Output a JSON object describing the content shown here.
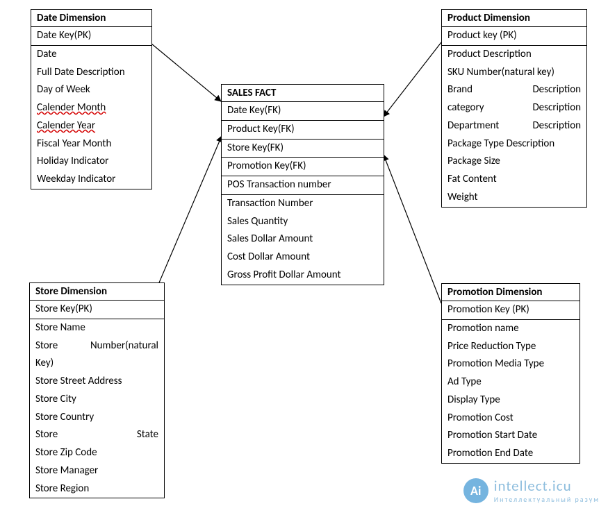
{
  "entities": {
    "date": {
      "title": "Date Dimension",
      "rows": [
        "Date Key(PK)",
        "Date",
        "Full Date Description",
        "Day of Week",
        "Calender Month",
        "Calender Year",
        "Fiscal Year Month",
        "Holiday Indicator",
        "Weekday Indicator"
      ]
    },
    "product": {
      "title": "Product Dimension",
      "rows": [
        "Product key (PK)",
        "Product Description",
        "SKU Number(natural key)"
      ],
      "pair_rows": [
        {
          "left": "Brand",
          "right": "Description"
        },
        {
          "left": "category",
          "right": "Description"
        },
        {
          "left": "Department",
          "right": "Description"
        }
      ],
      "rows2": [
        "Package Type Description",
        "Package Size",
        "Fat Content",
        "Weight"
      ]
    },
    "store": {
      "title": "Store Dimension",
      "rows": [
        "Store Key(PK)",
        "Store Name"
      ],
      "pair_rows": [
        {
          "left": "Store",
          "right": "Number(natural"
        }
      ],
      "rows2": [
        "Key)",
        "Store Street Address",
        "Store City",
        "Store Country"
      ],
      "pair_rows2": [
        {
          "left": "Store",
          "right": "State"
        }
      ],
      "rows3": [
        "Store Zip Code",
        "Store Manager",
        "Store Region"
      ]
    },
    "promotion": {
      "title": "Promotion Dimension",
      "rows": [
        "Promotion Key (PK)",
        "Promotion name",
        "Price Reduction Type",
        "Promotion Media Type",
        "Ad Type",
        "Display Type",
        "Promotion Cost",
        "Promotion Start Date",
        "Promotion End Date"
      ]
    },
    "fact": {
      "title": "SALES FACT",
      "rows": [
        "Date Key(FK)",
        "Product Key(FK)",
        "Store Key(FK)",
        "Promotion Key(FK)",
        "POS Transaction number",
        "Transaction Number",
        "Sales Quantity",
        "Sales Dollar Amount",
        "Cost Dollar Amount",
        "Gross Profit Dollar Amount"
      ]
    }
  },
  "watermark": {
    "badge": "Ai",
    "line1": "intellect.icu",
    "line2": "Интеллектуальный  разум"
  }
}
